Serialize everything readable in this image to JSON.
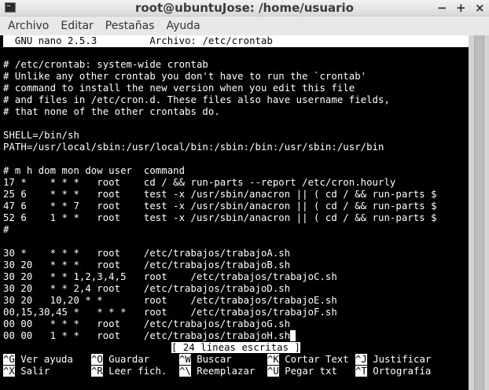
{
  "window": {
    "title": "root@ubuntuJose: /home/usuario",
    "controls": [
      "−",
      "+",
      "×"
    ]
  },
  "menu": [
    "Archivo",
    "Editar",
    "Pestañas",
    "Ayuda"
  ],
  "nano": {
    "version": "GNU nano 2.5.3",
    "file_label": "Archivo: /etc/crontab",
    "lines": [
      "",
      "# /etc/crontab: system-wide crontab",
      "# Unlike any other crontab you don't have to run the `crontab'",
      "# command to install the new version when you edit this file",
      "# and files in /etc/cron.d. These files also have username fields,",
      "# that none of the other crontabs do.",
      "",
      "SHELL=/bin/sh",
      "PATH=/usr/local/sbin:/usr/local/bin:/sbin:/bin:/usr/sbin:/usr/bin",
      "",
      "# m h dom mon dow user  command",
      "17 *    * * *   root    cd / && run-parts --report /etc/cron.hourly",
      "25 6    * * *   root    test -x /usr/sbin/anacron || ( cd / && run-parts $",
      "47 6    * * 7   root    test -x /usr/sbin/anacron || ( cd / && run-parts $",
      "52 6    1 * *   root    test -x /usr/sbin/anacron || ( cd / && run-parts $",
      "#",
      "",
      "30 *    * * *   root    /etc/trabajos/trabajoA.sh",
      "30 20   * * *   root    /etc/trabajos/trabajoB.sh",
      "30 20   * * 1,2,3,4,5   root    /etc/trabajos/trabajoC.sh",
      "30 20   * * 2,4 root    /etc/trabajos/trabajoD.sh",
      "30 20   10,20 * *       root    /etc/trabajos/trabajoE.sh",
      "00,15,30,45 *   * * *   root    /etc/trabajos/trabajoF.sh",
      "00 00   * * *   root    /etc/trabajos/trabajoG.sh",
      "00 00   1 * *   root    /etc/trabajos/trabajoH.sh"
    ],
    "status": "[ 24 líneas escritas ]",
    "shortcuts_row1": [
      {
        "key": "^G",
        "label": "Ver ayuda"
      },
      {
        "key": "^O",
        "label": "Guardar"
      },
      {
        "key": "^W",
        "label": "Buscar"
      },
      {
        "key": "^K",
        "label": "Cortar Text"
      },
      {
        "key": "^J",
        "label": "Justificar"
      }
    ],
    "shortcuts_row2": [
      {
        "key": "^X",
        "label": "Salir"
      },
      {
        "key": "^R",
        "label": "Leer fich."
      },
      {
        "key": "^\\",
        "label": "Reemplazar"
      },
      {
        "key": "^U",
        "label": "Pegar txt"
      },
      {
        "key": "^T",
        "label": "Ortografía"
      }
    ]
  },
  "colors": {
    "terminal_bg": "#000000",
    "terminal_fg": "#ffffff",
    "titlebar": "#e6e6e6"
  }
}
